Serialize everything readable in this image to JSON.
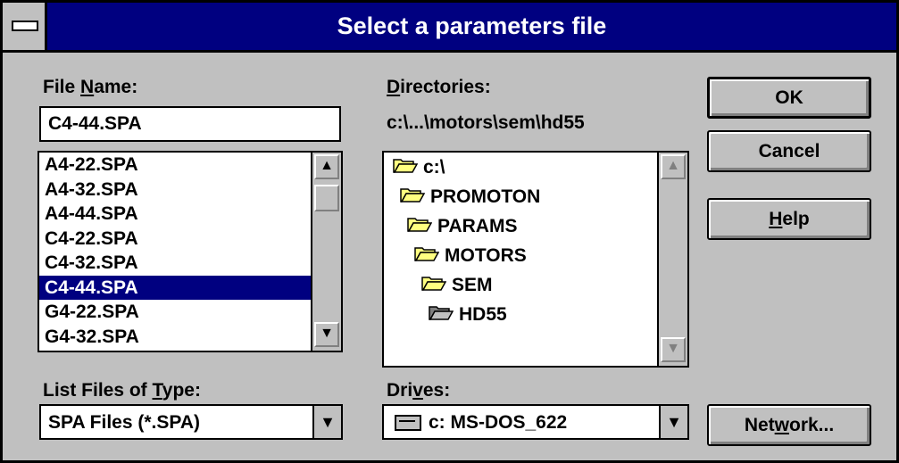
{
  "title": "Select a parameters file",
  "file_name": {
    "label_pre": "File ",
    "label_ul": "N",
    "label_post": "ame:",
    "value": "C4-44.SPA",
    "files": [
      "A4-22.SPA",
      "A4-32.SPA",
      "A4-44.SPA",
      "C4-22.SPA",
      "C4-32.SPA",
      "C4-44.SPA",
      "G4-22.SPA",
      "G4-32.SPA"
    ],
    "selected": "C4-44.SPA"
  },
  "directories": {
    "label_ul": "D",
    "label_post": "irectories:",
    "path": "c:\\...\\motors\\sem\\hd55",
    "items": [
      "c:\\",
      "PROMOTON",
      "PARAMS",
      "MOTORS",
      "SEM",
      "HD55"
    ]
  },
  "file_type": {
    "label_pre": "List Files of ",
    "label_ul": "T",
    "label_post": "ype:",
    "value": "SPA Files (*.SPA)"
  },
  "drives": {
    "label_pre": "Dri",
    "label_ul": "v",
    "label_post": "es:",
    "value": "c: MS-DOS_622"
  },
  "buttons": {
    "ok": "OK",
    "cancel": "Cancel",
    "help_ul": "H",
    "help_post": "elp",
    "network_pre": "Net",
    "network_ul": "w",
    "network_post": "ork..."
  },
  "colors": {
    "face": "#c0c0c0",
    "title_bar": "#000080",
    "selection": "#000080"
  }
}
